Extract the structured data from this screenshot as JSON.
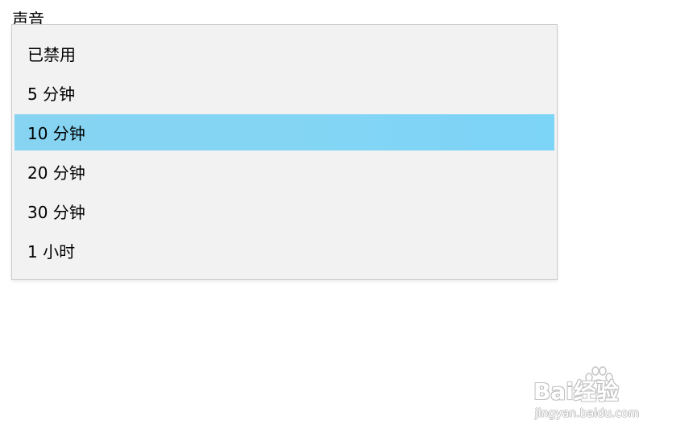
{
  "label_above": "声音",
  "dropdown": {
    "options": [
      {
        "label": "已禁用",
        "selected": false
      },
      {
        "label": "5 分钟",
        "selected": false
      },
      {
        "label": "10 分钟",
        "selected": true
      },
      {
        "label": "20 分钟",
        "selected": false
      },
      {
        "label": "30 分钟",
        "selected": false
      },
      {
        "label": "1 小时",
        "selected": false
      }
    ]
  },
  "watermark": {
    "brand_text": "Bai经验",
    "url": "jingyan.baidu.com"
  },
  "colors": {
    "dropdown_bg": "#f2f2f2",
    "selected_bg": "#84d5f4",
    "border": "#cccccc"
  }
}
